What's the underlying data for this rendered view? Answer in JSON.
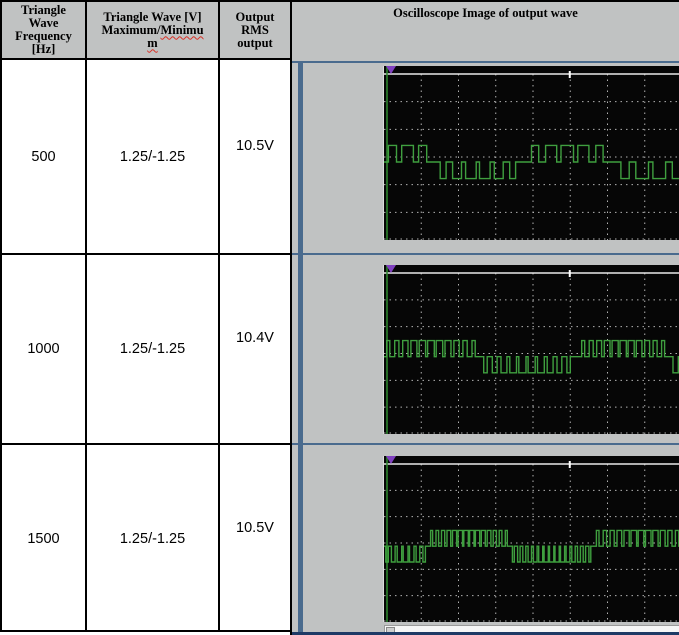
{
  "document": {
    "table": {
      "header": {
        "col1_lines": [
          "Triangle",
          "Wave",
          "Frequency",
          "[Hz]"
        ],
        "col2_line1": "Triangle Wave [V]",
        "col2_line2_prefix": "Maximum/",
        "col2_line2_misspelled": "Minimu",
        "col2_line3_misspelled": "m",
        "col3_lines": [
          "Output",
          "RMS",
          "output"
        ],
        "col4_title": "Oscilloscope Image of output wave"
      },
      "rows": [
        {
          "frequency_hz": "500",
          "triangle_wave_v": "1.25/-1.25",
          "rms_output": "10.5V"
        },
        {
          "frequency_hz": "1000",
          "triangle_wave_v": "1.25/-1.25",
          "rms_output": "10.4V"
        },
        {
          "frequency_hz": "1500",
          "triangle_wave_v": "1.25/-1.25",
          "rms_output": "10.5V"
        }
      ]
    }
  },
  "colors": {
    "cell_gray": "#c0c2c2",
    "table_border_black": "#000000",
    "image_border_blue": "#4a6b8e",
    "bottom_bar_navy": "#1e3a66",
    "scope_background": "#060606",
    "scope_grid": "#cfcfcf",
    "scope_top_line": "#e9e9e9",
    "trace_green": "#3f9f3f",
    "left_edge_green": "#2e8b2e",
    "trigger_marker_purple": "#8040c0",
    "spellcheck_red": "#d93025"
  },
  "scopes": [
    {
      "name": "output-wave-500hz",
      "baseline_frac": 0.53,
      "amplitude_frac": 0.1,
      "h_divisions": 8,
      "v_divisions": 6,
      "trigger_tick_frac": 0.62,
      "pulse_groups": [
        {
          "dir": 1,
          "from": 0.003,
          "to": 0.155,
          "pulses": 3
        },
        {
          "dir": -1,
          "from": 0.175,
          "to": 0.455,
          "pulses": 6
        },
        {
          "dir": 1,
          "from": 0.48,
          "to": 0.75,
          "pulses": 5
        },
        {
          "dir": -1,
          "from": 0.78,
          "to": 1.01,
          "pulses": 4
        }
      ]
    },
    {
      "name": "output-wave-1000hz",
      "baseline_frac": 0.52,
      "amplitude_frac": 0.1,
      "h_divisions": 8,
      "v_divisions": 6,
      "trigger_tick_frac": 0.62,
      "pulse_groups": [
        {
          "dir": 1,
          "from": 0.0,
          "to": 0.315,
          "pulses": 11
        },
        {
          "dir": -1,
          "from": 0.325,
          "to": 0.635,
          "pulses": 10
        },
        {
          "dir": 1,
          "from": 0.655,
          "to": 0.95,
          "pulses": 11
        },
        {
          "dir": -1,
          "from": 0.965,
          "to": 1.02,
          "pulses": 2
        }
      ]
    },
    {
      "name": "output-wave-1500hz",
      "baseline_frac": 0.52,
      "amplitude_frac": 0.1,
      "h_divisions": 8,
      "v_divisions": 6,
      "trigger_tick_frac": 0.62,
      "pulse_groups": [
        {
          "dir": -1,
          "from": 0.0,
          "to": 0.145,
          "pulses": 7
        },
        {
          "dir": 1,
          "from": 0.15,
          "to": 0.42,
          "pulses": 14
        },
        {
          "dir": -1,
          "from": 0.425,
          "to": 0.7,
          "pulses": 15
        },
        {
          "dir": 1,
          "from": 0.705,
          "to": 1.02,
          "pulses": 13
        }
      ]
    }
  ]
}
